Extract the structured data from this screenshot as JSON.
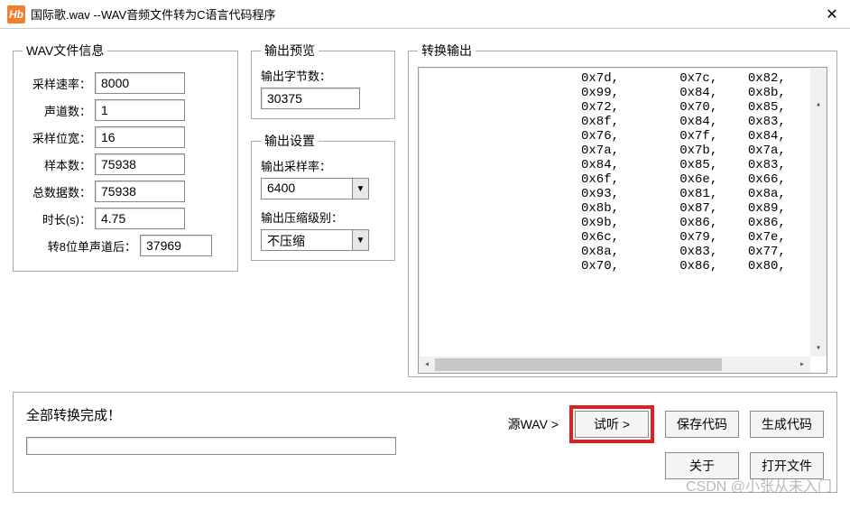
{
  "window": {
    "title": "国际歌.wav    --WAV音频文件转为C语言代码程序"
  },
  "wav_info": {
    "legend": "WAV文件信息",
    "sample_rate_label": "采样速率：",
    "sample_rate": "8000",
    "channels_label": "声道数：",
    "channels": "1",
    "bit_depth_label": "采样位宽：",
    "bit_depth": "16",
    "sample_count_label": "样本数：",
    "sample_count": "75938",
    "total_data_label": "总数据数：",
    "total_data": "75938",
    "duration_label": "时长(s)：",
    "duration": "4.75",
    "mono8_label": "转8位单声道后：",
    "mono8": "37969"
  },
  "out_preview": {
    "legend": "输出预览",
    "bytes_label": "输出字节数：",
    "bytes": "30375"
  },
  "out_settings": {
    "legend": "输出设置",
    "rate_label": "输出采样率：",
    "rate": "6400",
    "compress_label": "输出压缩级别：",
    "compress": "不压缩"
  },
  "conv_output": {
    "legend": "转换输出",
    "lines": [
      "0x7d,        0x7c,    0x82,",
      "0x99,        0x84,    0x8b,",
      "0x72,        0x70,    0x85,",
      "0x8f,        0x84,    0x83,",
      "0x76,        0x7f,    0x84,",
      "0x7a,        0x7b,    0x7a,",
      "0x84,        0x85,    0x83,",
      "0x6f,        0x6e,    0x66,",
      "0x93,        0x81,    0x8a,",
      "0x8b,        0x87,    0x89,",
      "0x9b,        0x86,    0x86,",
      "0x6c,        0x79,    0x7e,",
      "0x8a,        0x83,    0x77,",
      "0x70,        0x86,    0x80,"
    ]
  },
  "bottom": {
    "status": "全部转换完成！",
    "source_prefix": "源WAV >",
    "listen": "试听 >",
    "save_code": "保存代码",
    "gen_code": "生成代码",
    "about": "关于",
    "open_file": "打开文件"
  },
  "watermark": "CSDN @小张从未入门"
}
